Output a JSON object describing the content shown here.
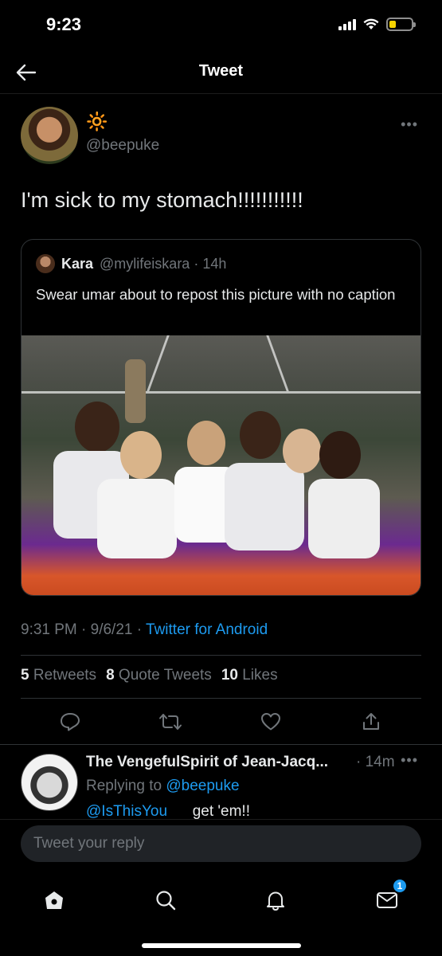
{
  "status_bar": {
    "time": "9:23"
  },
  "nav": {
    "title": "Tweet"
  },
  "tweet": {
    "author_name_emoji": "🔆",
    "author_handle": "@beepuke",
    "text": "I'm sick to my stomach!!!!!!!!!!!",
    "quote": {
      "name": "Kara",
      "meta": "@mylifeiskara · 14h",
      "text": "Swear umar about to repost this picture with no caption"
    },
    "timestamp": "9:31 PM · 9/6/21 · ",
    "source": "Twitter for Android",
    "stats": {
      "retweets_count": "5",
      "retweets_label": "Retweets",
      "quotes_count": "8",
      "quotes_label": "Quote Tweets",
      "likes_count": "10",
      "likes_label": "Likes"
    }
  },
  "reply": {
    "name": "The VengefulSpirit of Jean-Jacq...",
    "time": "· 14m",
    "replying_label": "Replying to ",
    "replying_to": "@beepuke",
    "mention": "@IsThisYou",
    "text": "get 'em!!"
  },
  "compose": {
    "placeholder": "Tweet your reply"
  },
  "tabbar": {
    "messages_badge": "1"
  },
  "colors": {
    "accent": "#1d9bf0",
    "background": "#000000",
    "muted": "#71767b"
  }
}
